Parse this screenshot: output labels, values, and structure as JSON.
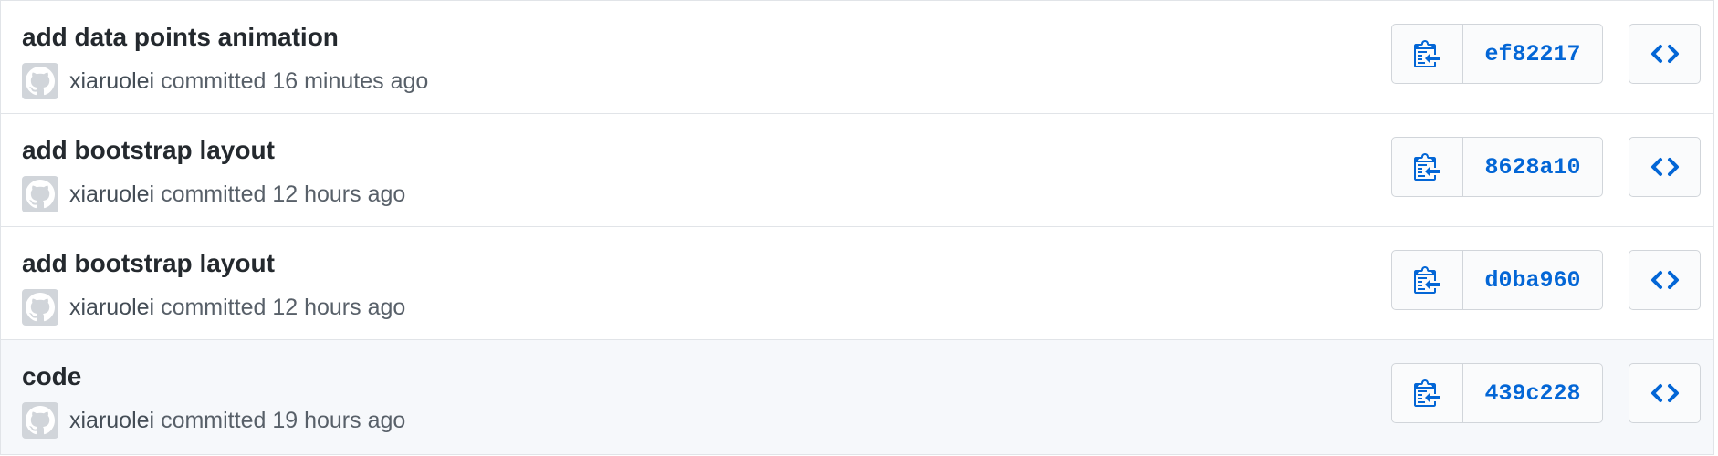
{
  "colors": {
    "link": "#0366d6",
    "title": "#24292e",
    "meta": "#586069",
    "border": "#e1e4e8",
    "highlight_row": "#f6f8fb"
  },
  "commits": [
    {
      "title": "add data points animation",
      "author": "xiaruolei",
      "action": "committed",
      "time": "16 minutes ago",
      "sha": "ef82217",
      "copy_icon": "clippy-icon",
      "browse_icon": "code-icon"
    },
    {
      "title": "add bootstrap layout",
      "author": "xiaruolei",
      "action": "committed",
      "time": "12 hours ago",
      "sha": "8628a10",
      "copy_icon": "clippy-icon",
      "browse_icon": "code-icon"
    },
    {
      "title": "add bootstrap layout",
      "author": "xiaruolei",
      "action": "committed",
      "time": "12 hours ago",
      "sha": "d0ba960",
      "copy_icon": "clippy-icon",
      "browse_icon": "code-icon"
    },
    {
      "title": "code",
      "author": "xiaruolei",
      "action": "committed",
      "time": "19 hours ago",
      "sha": "439c228",
      "copy_icon": "clippy-icon",
      "browse_icon": "code-icon"
    }
  ]
}
